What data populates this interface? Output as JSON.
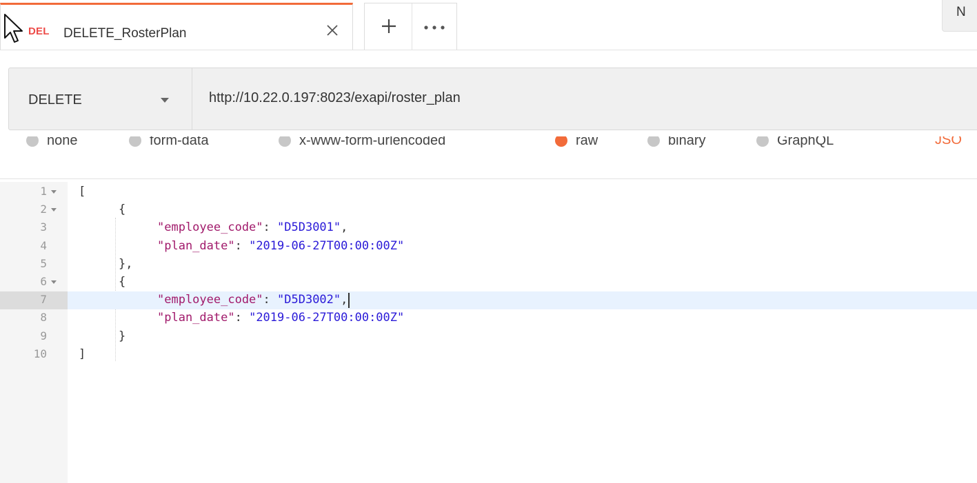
{
  "tabs": {
    "active": {
      "method_badge": "DEL",
      "name": "DELETE_RosterPlan"
    },
    "environment_text": "N"
  },
  "request": {
    "method": "DELETE",
    "url": "http://10.22.0.197:8023/exapi/roster_plan"
  },
  "body_types": {
    "options": [
      {
        "label": "none",
        "selected": false
      },
      {
        "label": "form-data",
        "selected": false
      },
      {
        "label": "x-www-form-urlencoded",
        "selected": false
      },
      {
        "label": "raw",
        "selected": true
      },
      {
        "label": "binary",
        "selected": false
      },
      {
        "label": "GraphQL",
        "selected": false
      }
    ],
    "format_label": "JSO"
  },
  "editor": {
    "active_line": 7,
    "lines": [
      {
        "num": "1",
        "fold": true,
        "indent": 0,
        "tokens": [
          {
            "t": "p",
            "v": "["
          }
        ]
      },
      {
        "num": "2",
        "fold": true,
        "indent": 1,
        "tokens": [
          {
            "t": "p",
            "v": "{"
          }
        ]
      },
      {
        "num": "3",
        "fold": false,
        "indent": 2,
        "tokens": [
          {
            "t": "k",
            "v": "\"employee_code\""
          },
          {
            "t": "p",
            "v": ": "
          },
          {
            "t": "s",
            "v": "\"D5D3001\""
          },
          {
            "t": "p",
            "v": ","
          }
        ]
      },
      {
        "num": "4",
        "fold": false,
        "indent": 2,
        "tokens": [
          {
            "t": "k",
            "v": "\"plan_date\""
          },
          {
            "t": "p",
            "v": ": "
          },
          {
            "t": "s",
            "v": "\"2019-06-27T00:00:00Z\""
          }
        ]
      },
      {
        "num": "5",
        "fold": false,
        "indent": 1,
        "tokens": [
          {
            "t": "p",
            "v": "},"
          }
        ]
      },
      {
        "num": "6",
        "fold": true,
        "indent": 1,
        "tokens": [
          {
            "t": "p",
            "v": "{"
          }
        ]
      },
      {
        "num": "7",
        "fold": false,
        "indent": 2,
        "tokens": [
          {
            "t": "k",
            "v": "\"employee_code\""
          },
          {
            "t": "p",
            "v": ": "
          },
          {
            "t": "s",
            "v": "\"D5D3002\""
          },
          {
            "t": "p",
            "v": ","
          }
        ]
      },
      {
        "num": "8",
        "fold": false,
        "indent": 2,
        "tokens": [
          {
            "t": "k",
            "v": "\"plan_date\""
          },
          {
            "t": "p",
            "v": ": "
          },
          {
            "t": "s",
            "v": "\"2019-06-27T00:00:00Z\""
          }
        ]
      },
      {
        "num": "9",
        "fold": false,
        "indent": 1,
        "tokens": [
          {
            "t": "p",
            "v": "}"
          }
        ]
      },
      {
        "num": "10",
        "fold": false,
        "indent": 0,
        "tokens": [
          {
            "t": "p",
            "v": "]"
          }
        ]
      }
    ]
  },
  "colors": {
    "accent": "#f26b3a",
    "method_delete": "#ed4b48",
    "json_key": "#a11a6b",
    "json_string": "#2a1ad8",
    "active_line": "#e8f2fe"
  },
  "icons": {
    "tab_close": "close-icon",
    "new_tab": "plus-icon",
    "tab_menu": "more-icon",
    "method_dropdown": "chevron-down-icon",
    "pointer": "mouse-pointer-icon"
  }
}
